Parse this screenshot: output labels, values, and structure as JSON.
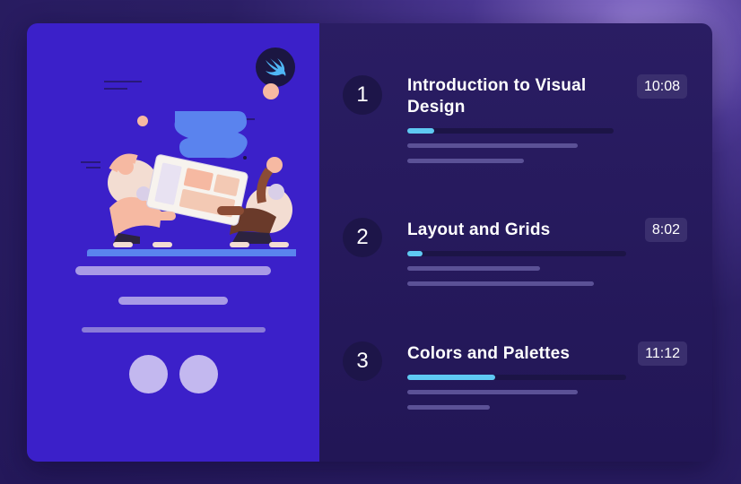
{
  "swift_icon": "swift-logo-icon",
  "illustration": "two-people-holding-tablet-illustration",
  "colors": {
    "left_panel": "#3b20c9",
    "right_panel": "#251959",
    "progress": "#5fc9f2"
  },
  "lessons": [
    {
      "number": "1",
      "title": "Introduction to Visual Design",
      "duration": "10:08",
      "progress": 0.13
    },
    {
      "number": "2",
      "title": "Layout and Grids",
      "duration": "8:02",
      "progress": 0.07
    },
    {
      "number": "3",
      "title": "Colors and Palettes",
      "duration": "11:12",
      "progress": 0.4
    }
  ]
}
